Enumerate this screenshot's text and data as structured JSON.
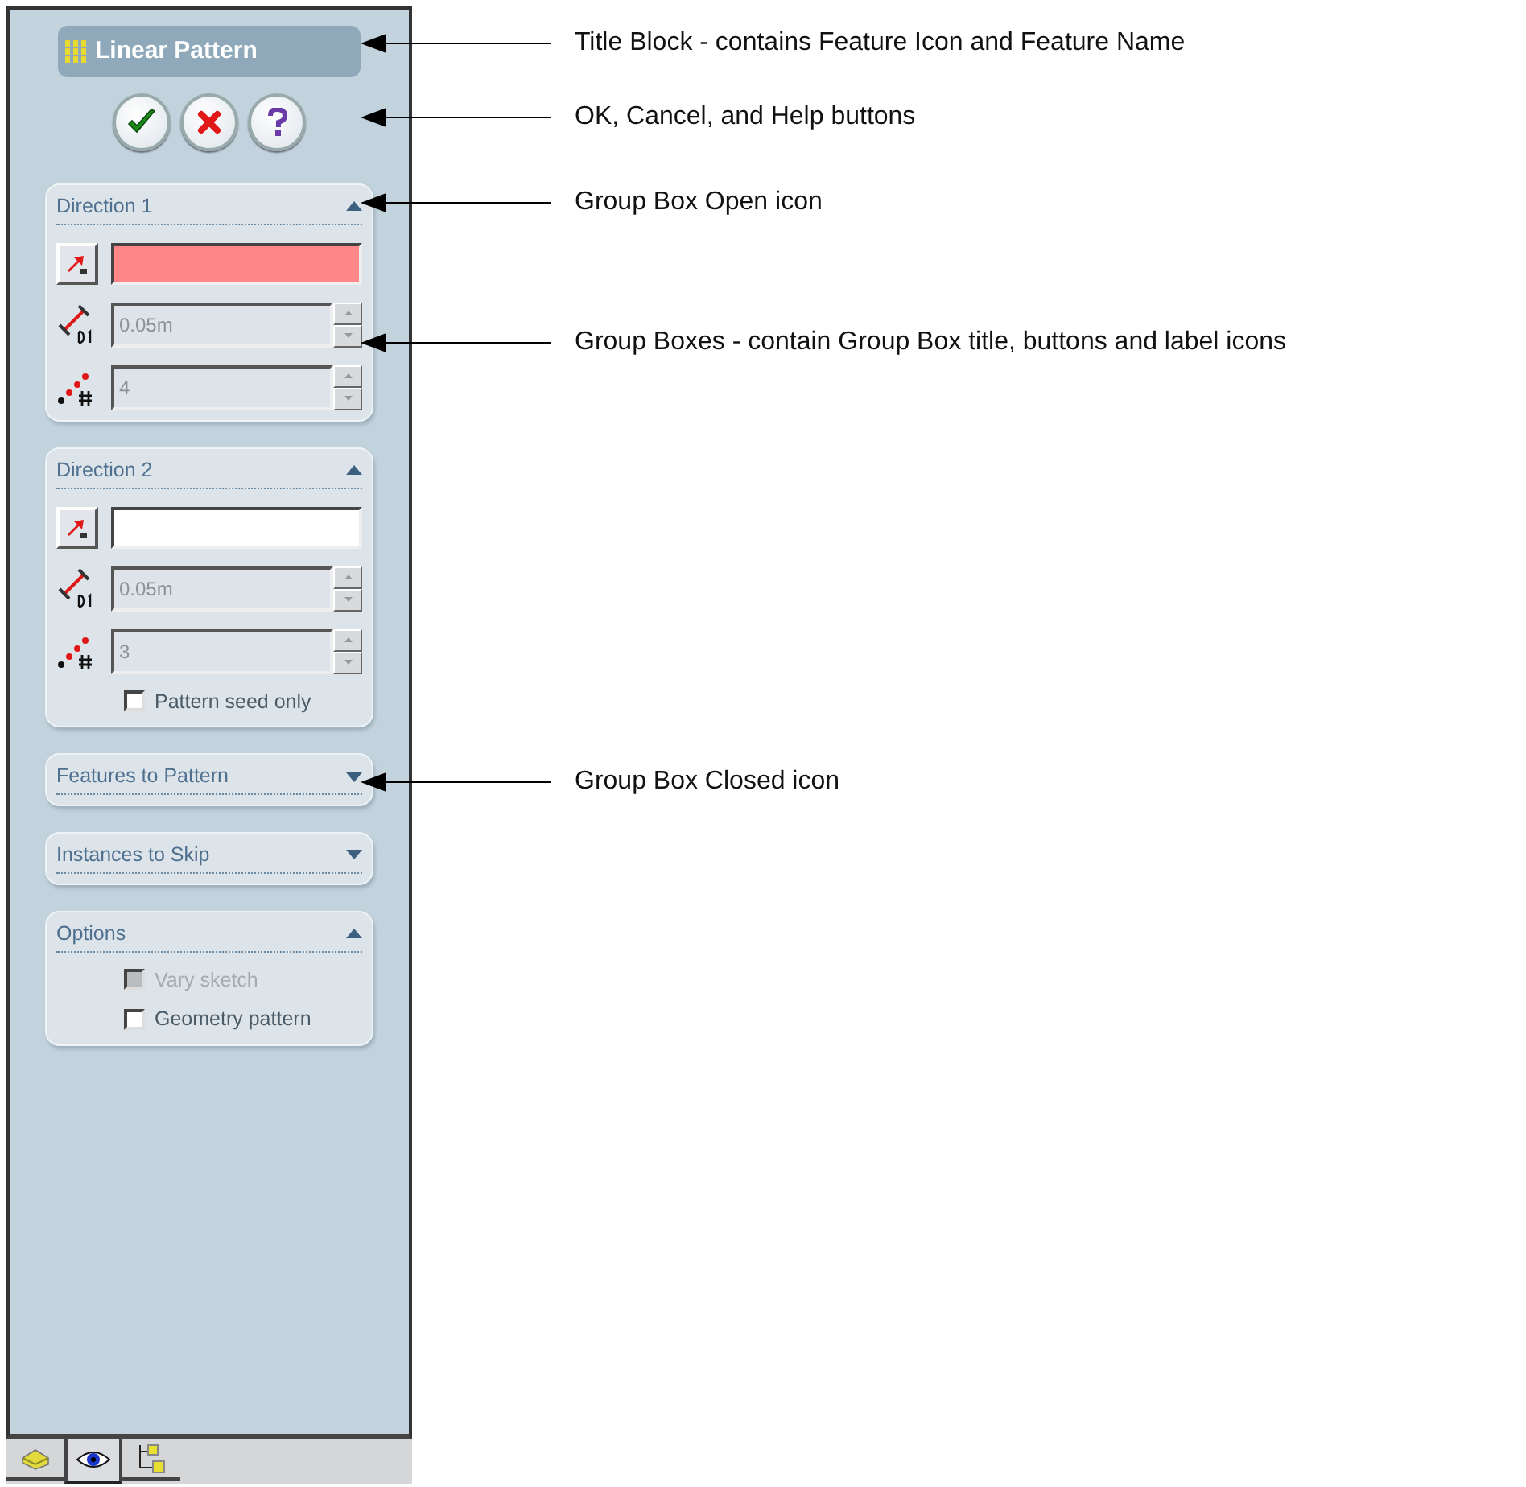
{
  "title_block": {
    "title": "Linear Pattern"
  },
  "buttons": [
    {
      "kind": "ok"
    },
    {
      "kind": "cancel"
    },
    {
      "kind": "help"
    }
  ],
  "groups": [
    {
      "title": "Direction 1",
      "expanded": true,
      "rows": [
        {
          "kind": "selection",
          "active": true
        },
        {
          "kind": "distance",
          "value": "0.05m",
          "disabled": true
        },
        {
          "kind": "count",
          "value": "4",
          "disabled": true
        }
      ]
    },
    {
      "title": "Direction 2",
      "expanded": true,
      "rows": [
        {
          "kind": "selection",
          "active": false
        },
        {
          "kind": "distance",
          "value": "0.05m",
          "disabled": true
        },
        {
          "kind": "count",
          "value": "3",
          "disabled": true
        },
        {
          "kind": "checkbox",
          "label": "Pattern seed only",
          "checked": false,
          "disabled": false
        }
      ]
    },
    {
      "title": "Features to Pattern",
      "expanded": false
    },
    {
      "title": "Instances to Skip",
      "expanded": false
    },
    {
      "title": "Options",
      "expanded": true,
      "rows": [
        {
          "kind": "checkbox",
          "label": "Vary sketch",
          "checked": false,
          "disabled": true
        },
        {
          "kind": "checkbox",
          "label": "Geometry pattern",
          "checked": false,
          "disabled": false
        }
      ]
    }
  ],
  "tabs": [
    {
      "kind": "feature",
      "selected": false
    },
    {
      "kind": "display",
      "selected": true
    },
    {
      "kind": "configuration",
      "selected": false
    }
  ],
  "callouts": [
    {
      "text": "Title Block - contains Feature Icon and Feature Name"
    },
    {
      "text": "OK, Cancel, and Help buttons"
    },
    {
      "text": "Group Box Open icon"
    },
    {
      "text": "Group Boxes - contain Group Box title, buttons and label icons"
    },
    {
      "text": "Group Box Closed icon"
    }
  ]
}
